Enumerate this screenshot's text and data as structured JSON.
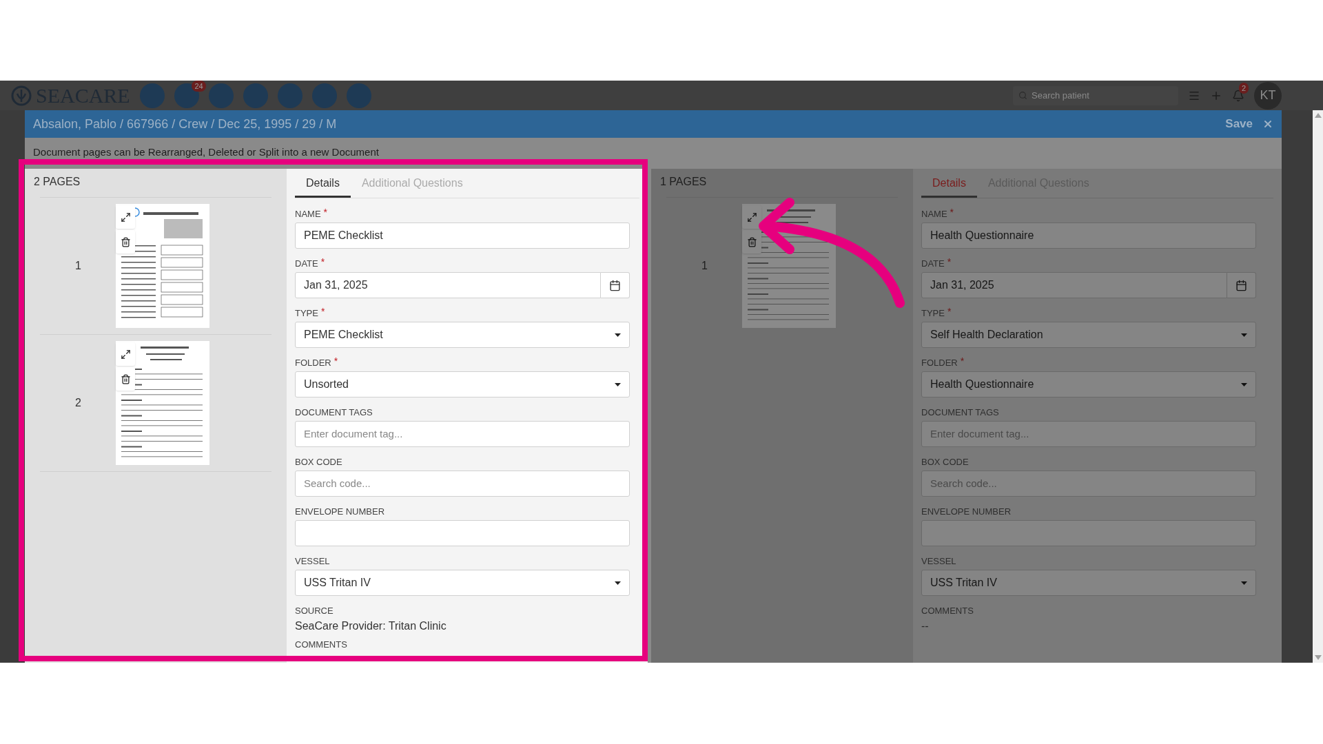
{
  "app_bar": {
    "logo": "SEACARE",
    "nav_badge": "24",
    "search": {
      "placeholder": "Search patient"
    },
    "notification_count": "2",
    "avatar": "KT"
  },
  "modal": {
    "title": "Absalon, Pablo / 667966 / Crew / Dec 25, 1995 / 29 / M",
    "save": "Save"
  },
  "notice": "Document pages can be Rearranged, Deleted or Split into a new Document",
  "documents": [
    {
      "dimmed": false,
      "highlighted": true,
      "pages_label": "2 PAGES",
      "pages": [
        {
          "number": "1"
        },
        {
          "number": "2"
        }
      ],
      "tabs": [
        {
          "label": "Details",
          "selected": true
        },
        {
          "label": "Additional Questions",
          "selected": false
        }
      ],
      "fields": [
        {
          "kind": "text",
          "label": "NAME",
          "required_mark": "*",
          "value": "PEME Checklist"
        },
        {
          "kind": "date",
          "label": "DATE",
          "required_mark": "*",
          "value": "Jan 31, 2025"
        },
        {
          "kind": "select",
          "label": "TYPE",
          "required_mark": "*",
          "value": "PEME Checklist"
        },
        {
          "kind": "select",
          "label": "FOLDER",
          "required_mark": "*",
          "value": "Unsorted"
        },
        {
          "kind": "text",
          "label": "DOCUMENT TAGS",
          "placeholder": "Enter document tag..."
        },
        {
          "kind": "text",
          "label": "BOX CODE",
          "placeholder": "Search code..."
        },
        {
          "kind": "text",
          "label": "ENVELOPE NUMBER"
        },
        {
          "kind": "select",
          "label": "VESSEL",
          "value": "USS Tritan IV"
        },
        {
          "kind": "static",
          "label": "SOURCE",
          "value": "SeaCare Provider: Tritan Clinic"
        },
        {
          "kind": "static",
          "label": "COMMENTS"
        }
      ]
    },
    {
      "dimmed": true,
      "highlighted": false,
      "pages_label": "1 PAGES",
      "pages": [
        {
          "number": "1"
        }
      ],
      "tabs": [
        {
          "label": "Details",
          "selected": true
        },
        {
          "label": "Additional Questions",
          "selected": false
        }
      ],
      "fields": [
        {
          "kind": "text",
          "label": "NAME",
          "required_mark": "*",
          "value": "Health Questionnaire"
        },
        {
          "kind": "date",
          "label": "DATE",
          "required_mark": "*",
          "value": "Jan 31, 2025"
        },
        {
          "kind": "select",
          "label": "TYPE",
          "required_mark": "*",
          "value": "Self Health Declaration"
        },
        {
          "kind": "select",
          "label": "FOLDER",
          "required_mark": "*",
          "value": "Health Questionnaire"
        },
        {
          "kind": "text",
          "label": "DOCUMENT TAGS",
          "placeholder": "Enter document tag..."
        },
        {
          "kind": "text",
          "label": "BOX CODE",
          "placeholder": "Search code..."
        },
        {
          "kind": "text",
          "label": "ENVELOPE NUMBER"
        },
        {
          "kind": "select",
          "label": "VESSEL",
          "value": "USS Tritan IV"
        },
        {
          "kind": "static",
          "label": "COMMENTS",
          "value": "--"
        }
      ]
    }
  ]
}
